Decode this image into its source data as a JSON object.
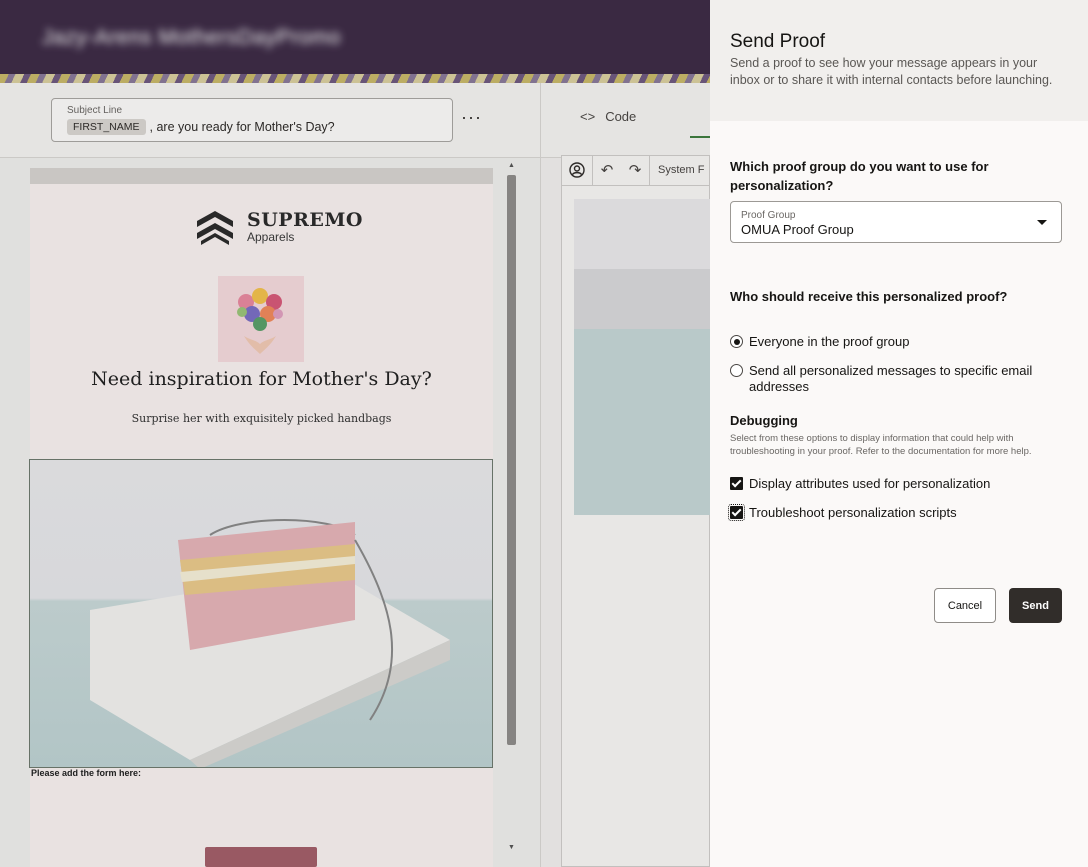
{
  "app": {
    "title": "Jazy-Arens MothersDayPromo"
  },
  "subject": {
    "label": "Subject Line",
    "token": "FIRST_NAME",
    "text": ", are you ready for Mother's Day?"
  },
  "toolbar": {
    "more": "···",
    "code_tab": "Code",
    "code_icon": "<>",
    "system_font": "System F"
  },
  "email": {
    "brand": "SUPREMO",
    "brand_sub": "Apparels",
    "headline": "Need inspiration for Mother's Day?",
    "subline": "Surprise her with exquisitely picked handbags",
    "form_label": "Please add the form here:"
  },
  "drawer": {
    "title": "Send Proof",
    "description": "Send a proof to see how your message appears in your inbox or to share it with internal contacts before launching.",
    "group_question": "Which proof group do you want to use for personalization?",
    "group_select": {
      "label": "Proof Group",
      "value": "OMUA Proof Group"
    },
    "recipient_question": "Who should receive this personalized proof?",
    "radios": [
      {
        "label": "Everyone in the proof group",
        "checked": true
      },
      {
        "label": "Send all personalized messages to specific email addresses",
        "checked": false
      }
    ],
    "debugging": {
      "title": "Debugging",
      "description": "Select from these options to display information that could help with troubleshooting in your proof. Refer to the documentation for more help.",
      "options": [
        {
          "label": "Display attributes used for personalization",
          "checked": true
        },
        {
          "label": "Troubleshoot personalization scripts",
          "checked": true
        }
      ]
    },
    "cancel_label": "Cancel",
    "send_label": "Send"
  },
  "colors": {
    "header_bg": "#3e2c47",
    "send_button": "#312d2a",
    "drawer_bg": "#fbf9f8"
  },
  "icons": [
    "code-icon",
    "person-circle-icon",
    "undo-icon",
    "redo-icon",
    "dropdown-caret-icon",
    "supremo-logo-icon"
  ]
}
